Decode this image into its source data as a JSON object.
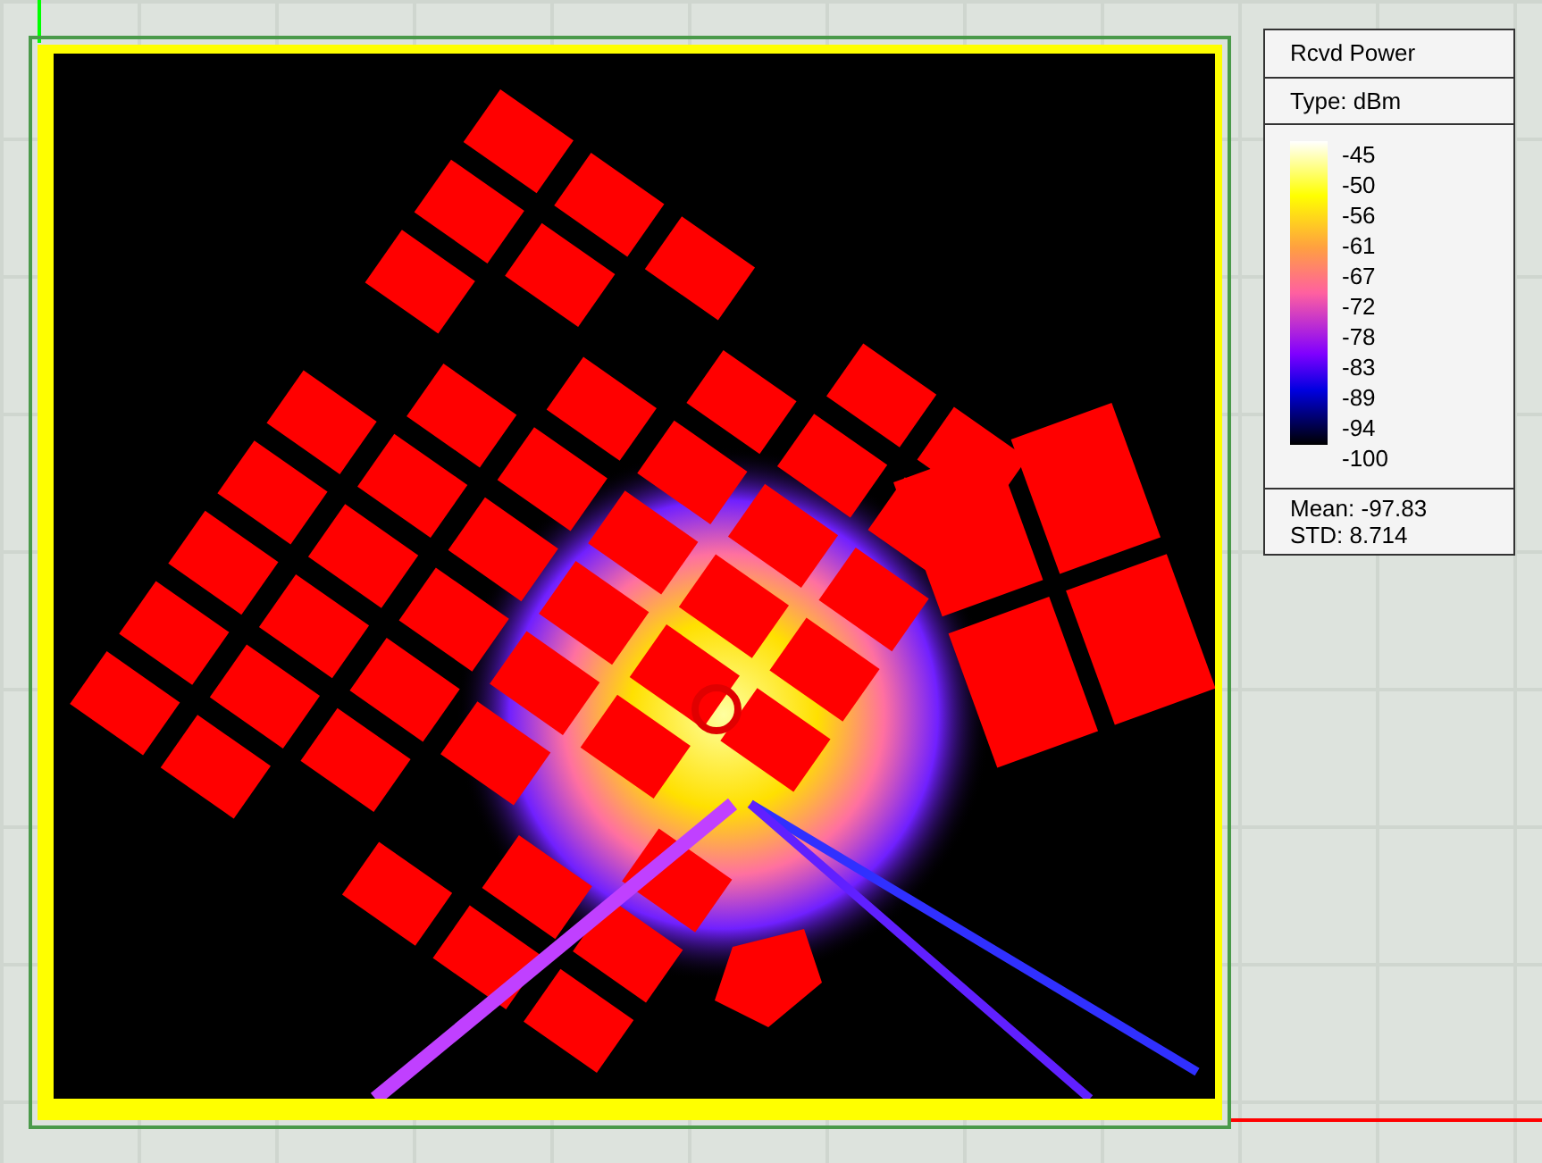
{
  "legend": {
    "title": "Rcvd Power",
    "type_label": "Type: dBm",
    "scale": [
      "-45",
      "-50",
      "-56",
      "-61",
      "-67",
      "-72",
      "-78",
      "-83",
      "-89",
      "-94",
      "-100"
    ],
    "mean": "Mean: -97.83",
    "std": "STD: 8.714"
  }
}
